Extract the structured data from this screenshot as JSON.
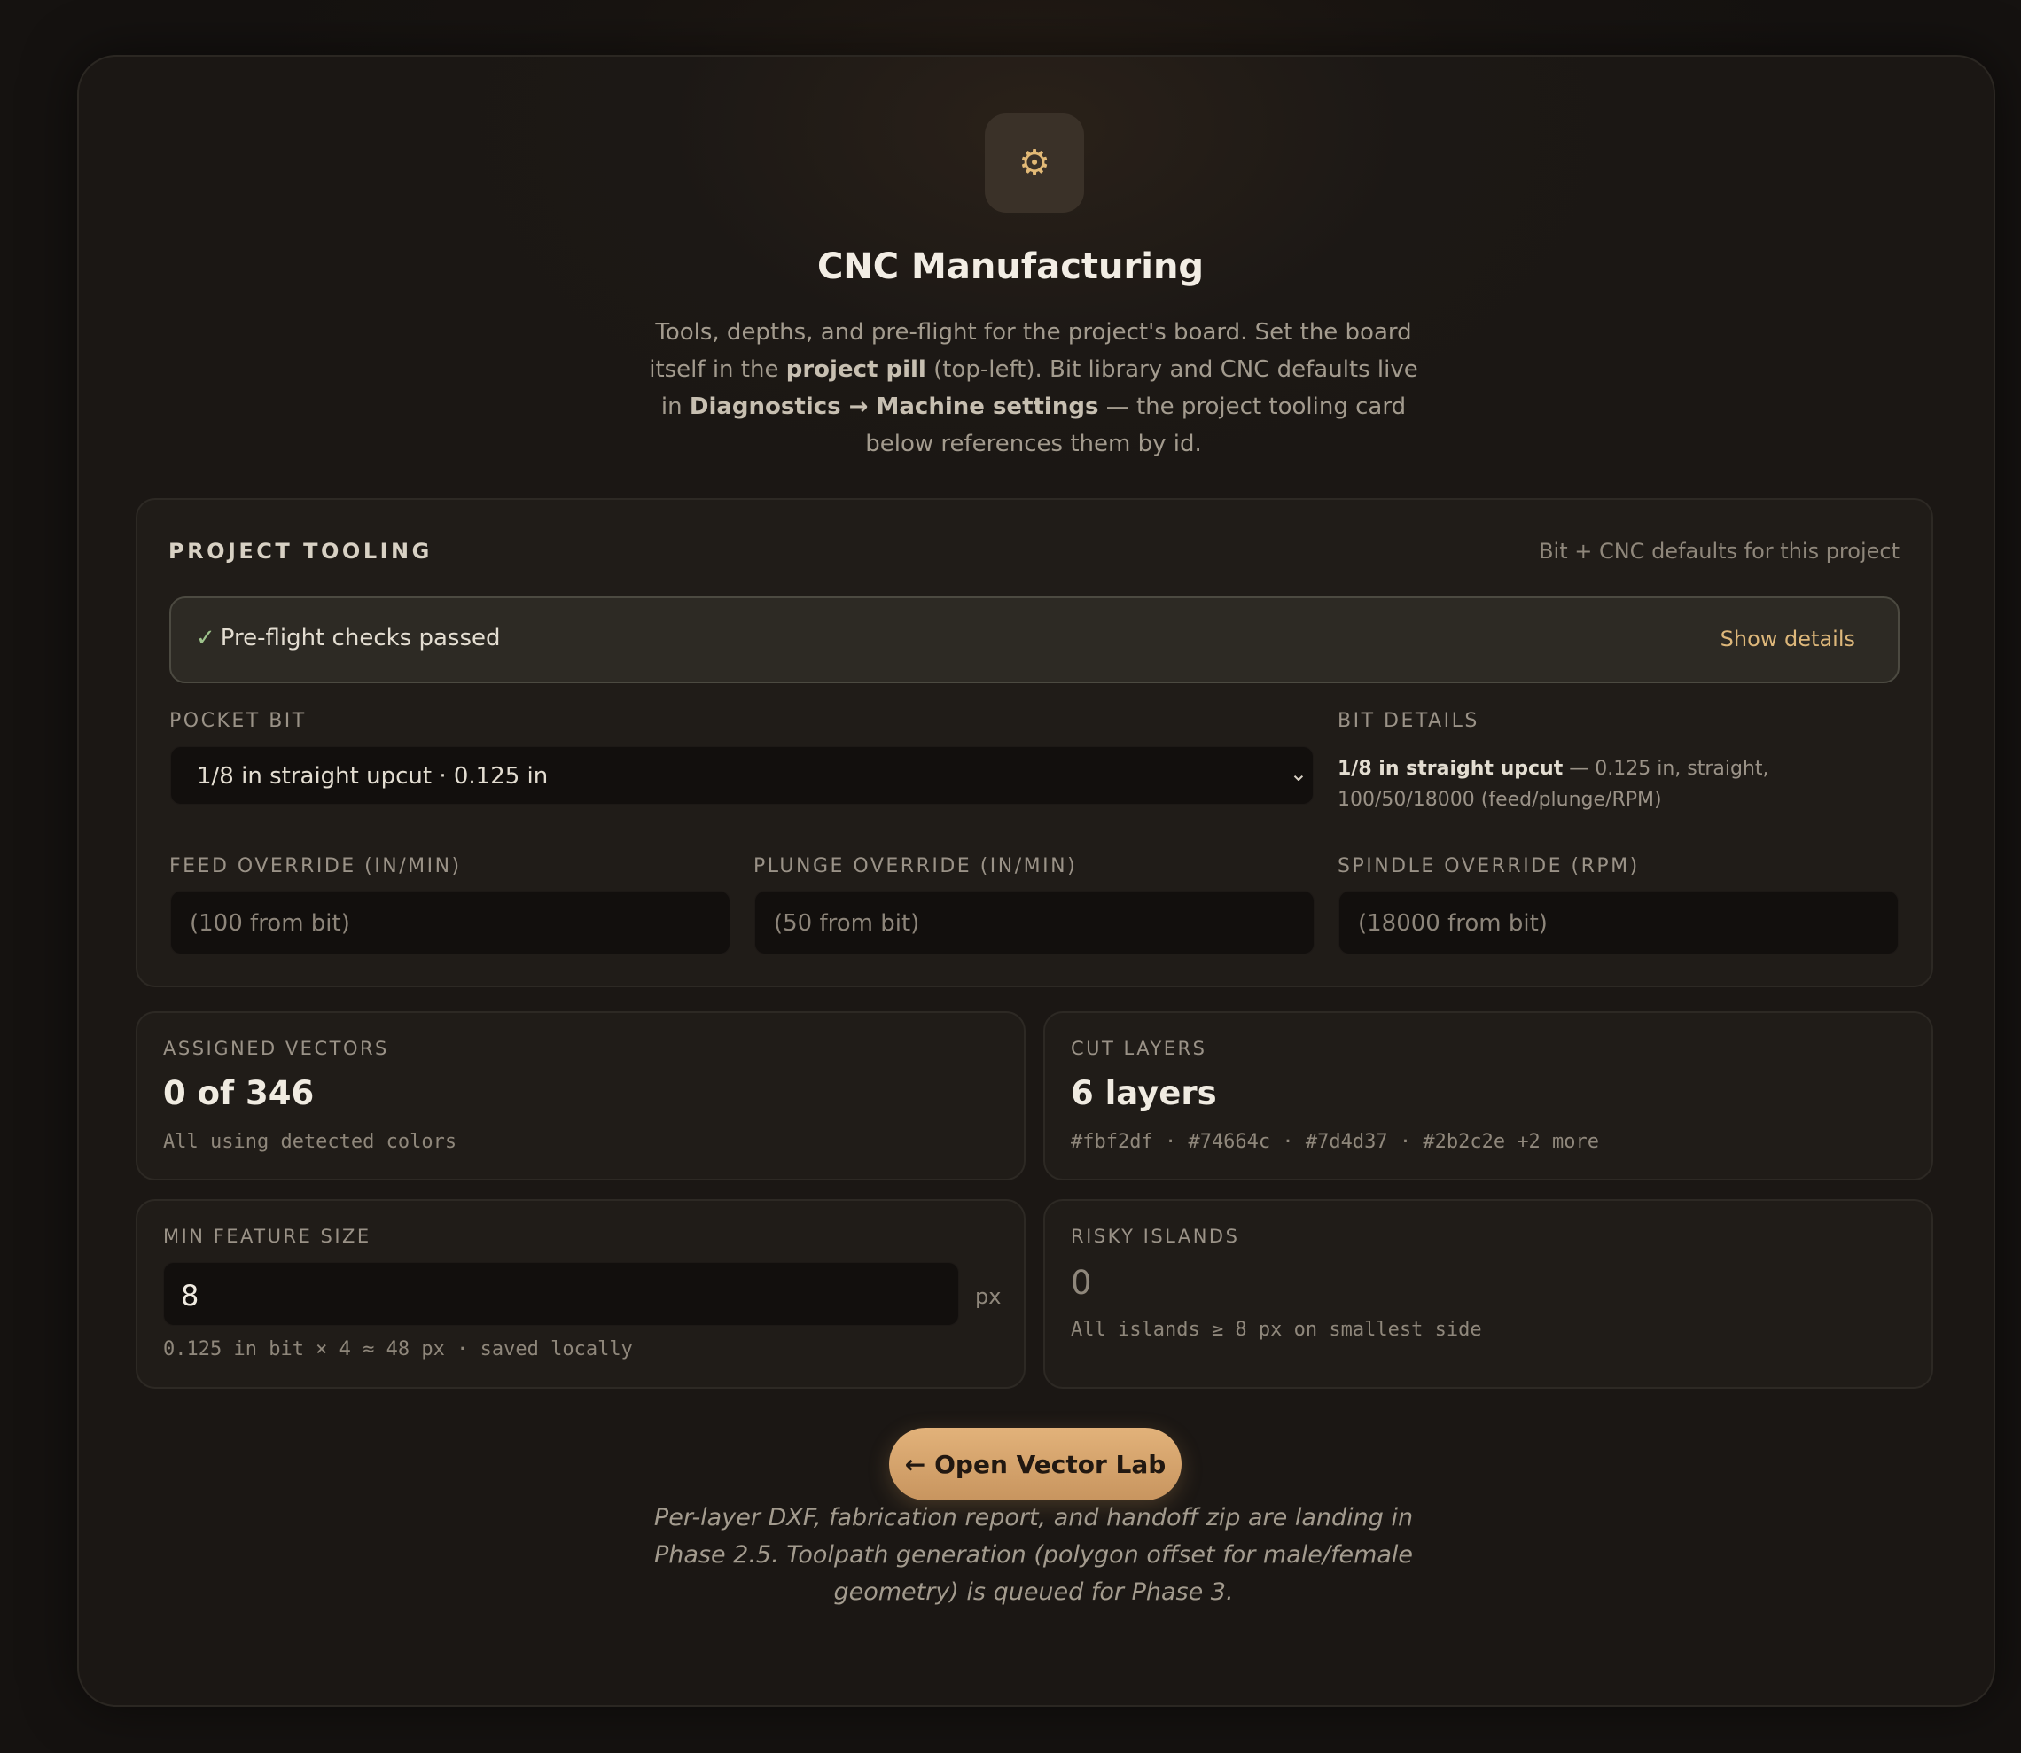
{
  "header": {
    "icon": "gear-icon",
    "title": "CNC Manufacturing",
    "desc_part1": "Tools, depths, and pre-flight for the project's board. Set the board itself in the ",
    "desc_bold1": "project pill",
    "desc_part2": " (top-left). Bit library and CNC defaults live in ",
    "desc_bold2": "Diagnostics → Machine settings",
    "desc_part3": " — the project tooling card below references them by id."
  },
  "tooling": {
    "title": "PROJECT TOOLING",
    "subtitle": "Bit + CNC defaults for this project",
    "preflight": {
      "check": "✓",
      "text": "Pre-flight checks passed",
      "link": "Show details"
    },
    "pocket_bit": {
      "label": "POCKET BIT",
      "value": "1/8 in straight upcut · 0.125 in"
    },
    "bit_details": {
      "label": "BIT DETAILS",
      "name": "1/8 in straight upcut",
      "text": " — 0.125 in, straight, 100/50/18000 (feed/plunge/RPM)"
    },
    "feed": {
      "label": "FEED OVERRIDE (IN/MIN)",
      "placeholder": "(100 from bit)"
    },
    "plunge": {
      "label": "PLUNGE OVERRIDE (IN/MIN)",
      "placeholder": "(50 from bit)"
    },
    "spindle": {
      "label": "SPINDLE OVERRIDE (RPM)",
      "placeholder": "(18000 from bit)"
    }
  },
  "stats": {
    "assigned": {
      "label": "ASSIGNED VECTORS",
      "value": "0 of 346",
      "detail": "All using detected colors"
    },
    "layers": {
      "label": "CUT LAYERS",
      "value": "6 layers",
      "detail": "#fbf2df · #74664c · #7d4d37 · #2b2c2e +2 more"
    },
    "min_feature": {
      "label": "MIN FEATURE SIZE",
      "value": "8",
      "unit": "px",
      "detail": "0.125 in bit × 4 ≈ 48 px · saved locally"
    },
    "islands": {
      "label": "RISKY ISLANDS",
      "value": "0",
      "detail": "All islands ≥ 8 px on smallest side"
    }
  },
  "cta": {
    "arrow": "←",
    "label": "Open Vector Lab"
  },
  "note": "Per-layer DXF, fabrication report, and handoff zip are landing in Phase 2.5. Toolpath generation (polygon offset for male/female geometry) is queued for Phase 3.",
  "colors": {
    "accent": "#ddb77a",
    "cta": "#d9a56d",
    "background": "#151210",
    "card": "#201c18"
  }
}
